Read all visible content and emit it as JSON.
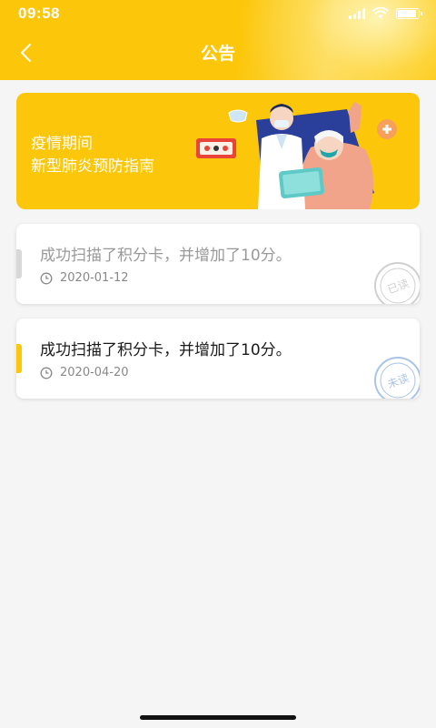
{
  "status_bar": {
    "time": "09:58"
  },
  "nav": {
    "title": "公告"
  },
  "banner": {
    "line1": "疫情期间",
    "line2": "新型肺炎预防指南"
  },
  "notices": [
    {
      "title": "成功扫描了积分卡，并增加了10分。",
      "date": "2020-01-12",
      "state": "read",
      "stamp_text": "已读"
    },
    {
      "title": "成功扫描了积分卡，并增加了10分。",
      "date": "2020-04-20",
      "state": "unread",
      "stamp_text": "未读"
    }
  ],
  "colors": {
    "brand": "#fcc60a",
    "read_marker": "#d8d8d8",
    "unread_marker": "#fcc60a",
    "read_text": "#999999",
    "unread_text": "#1a1a1a",
    "unread_stamp": "#a9c4e6",
    "read_stamp": "#d0d0d0"
  },
  "icons": [
    "signal-icon",
    "wifi-icon",
    "battery-icon",
    "back-chevron-icon",
    "clock-icon",
    "stamp-icon"
  ]
}
